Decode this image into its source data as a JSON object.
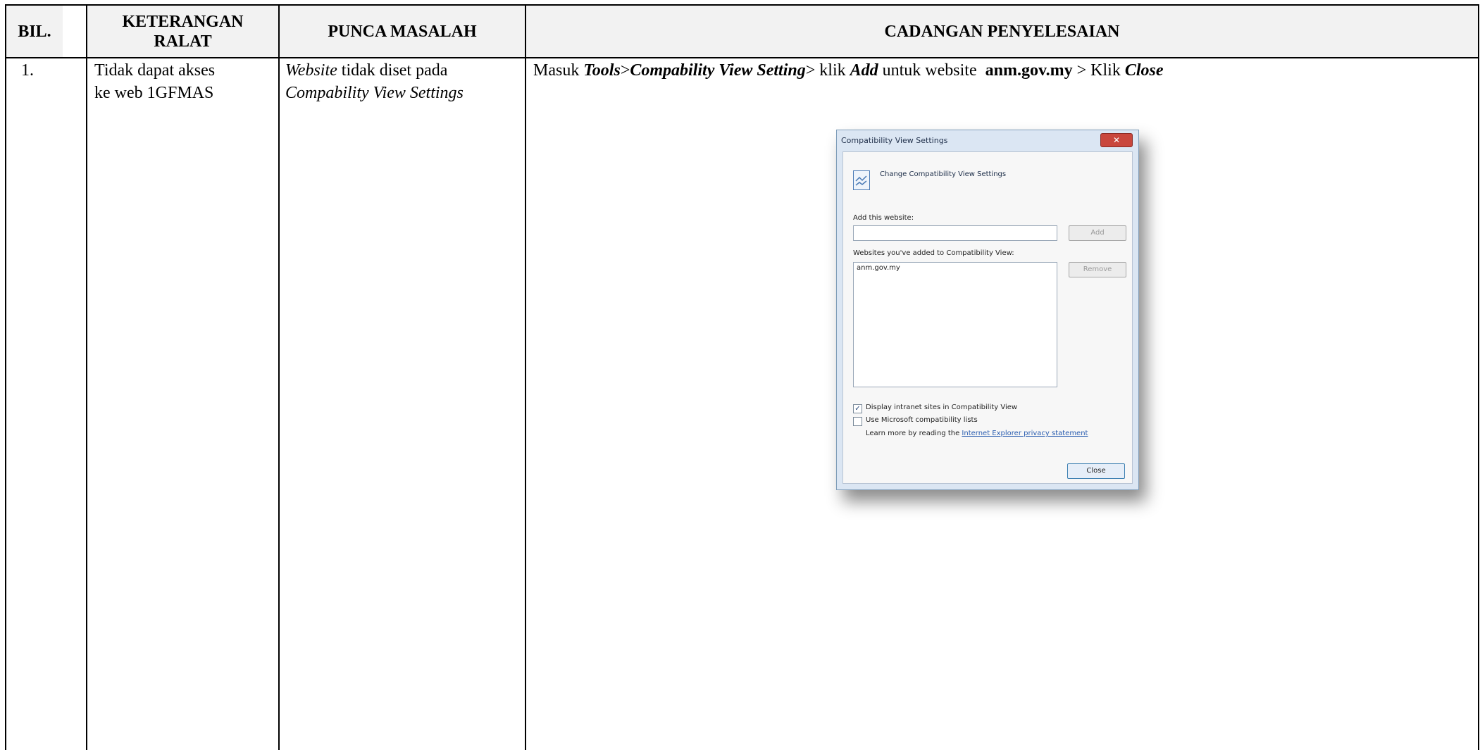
{
  "table": {
    "headers": {
      "bil": "BIL.",
      "keterangan": "KETERANGAN RALAT",
      "punca": "PUNCA MASALAH",
      "cadangan": "CADANGAN PENYELESAIAN"
    },
    "row": {
      "bil": "1.",
      "keterangan_line1": "Tidak dapat akses",
      "keterangan_line2": "ke web 1GFMAS",
      "punca_word1": "Website",
      "punca_rest1": " tidak diset pada",
      "punca_line2": "Compability View Settings",
      "cadangan": {
        "t1": "Masuk ",
        "tools": "Tools",
        "gt1": ">",
        "setting": "Compability View Setting",
        "t2": "> klik ",
        "add": "Add",
        "t3": " untuk website  ",
        "site": "anm.gov.my",
        "t4": " > Klik ",
        "close": "Close"
      }
    }
  },
  "dialog": {
    "title": "Compatibility View Settings",
    "close_glyph": "✕",
    "heading": "Change Compatibility View Settings",
    "add_label": "Add this website:",
    "add_button": "Add",
    "list_label": "Websites you've added to Compatibility View:",
    "list_items": [
      "anm.gov.my"
    ],
    "remove_button": "Remove",
    "check1_label": "Display intranet sites in Compatibility View",
    "check1_checked": true,
    "check2_label": "Use Microsoft compatibility lists",
    "check2_checked": false,
    "learn_text": "Learn more by reading the ",
    "learn_link": "Internet Explorer privacy statement",
    "close_button": "Close",
    "check_mark": "✓",
    "colors": {
      "frame": "#dbe6f3",
      "close_red": "#c9473d",
      "link": "#2a5db0"
    }
  }
}
